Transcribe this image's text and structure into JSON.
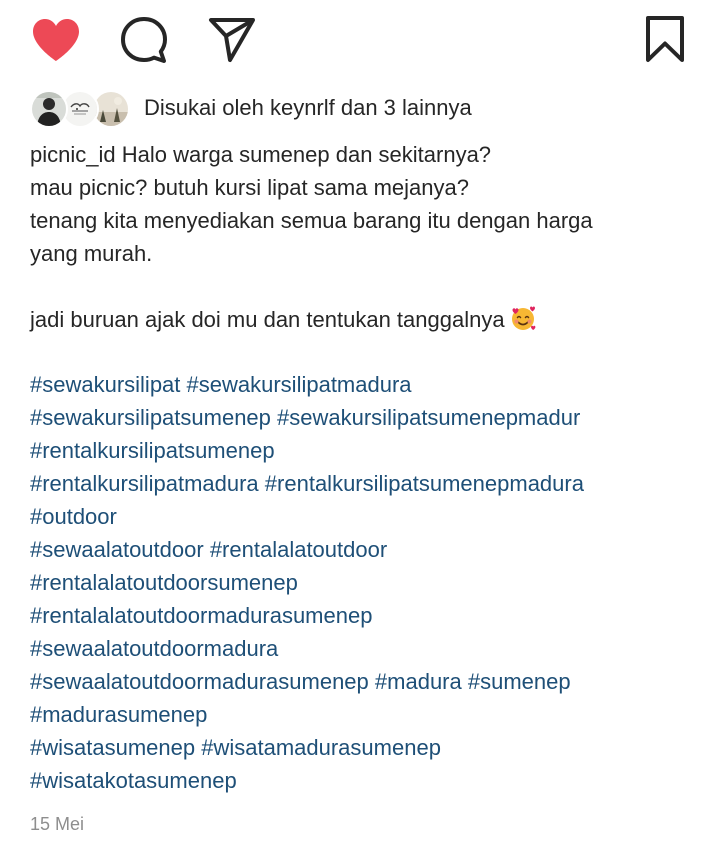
{
  "colors": {
    "like_red": "#ed4956",
    "text": "#262626",
    "hashtag": "#1e4f77",
    "muted": "#8e8e8e"
  },
  "actions": {
    "like_icon": "heart-filled-icon",
    "comment_icon": "speech-bubble-icon",
    "share_icon": "paper-plane-icon",
    "save_icon": "bookmark-icon"
  },
  "likes": {
    "text": "Disukai oleh keynrlf dan 3 lainnya"
  },
  "caption": {
    "lines": [
      "picnic_id Halo warga sumenep dan sekitarnya?",
      "mau picnic? butuh kursi lipat sama mejanya?",
      "tenang kita menyediakan semua barang itu dengan harga",
      "yang murah.",
      "",
      "jadi buruan ajak doi mu dan tentukan tanggalnya"
    ],
    "emoji": "smiling-face-with-hearts-emoji"
  },
  "hashtag_lines": [
    [
      "#sewakursilipat",
      "#sewakursilipatmadura"
    ],
    [
      "#sewakursilipatsumenep",
      "#sewakursilipatsumenepmadur"
    ],
    [
      "#rentalkursilipatsumenep"
    ],
    [
      "#rentalkursilipatmadura",
      "#rentalkursilipatsumenepmadura"
    ],
    [
      "#outdoor"
    ],
    [
      "#sewaalatoutdoor",
      "#rentalalatoutdoor"
    ],
    [
      "#rentalalatoutdoorsumenep"
    ],
    [
      "#rentalalatoutdoormadurasumenep"
    ],
    [
      "#sewaalatoutdoormadura"
    ],
    [
      "#sewaalatoutdoormadurasumenep",
      "#madura",
      "#sumenep"
    ],
    [
      "#madurasumenep"
    ],
    [
      "#wisatasumenep",
      "#wisatamadurasumenep"
    ],
    [
      "#wisatakotasumenep"
    ]
  ],
  "timestamp": "15 Mei"
}
